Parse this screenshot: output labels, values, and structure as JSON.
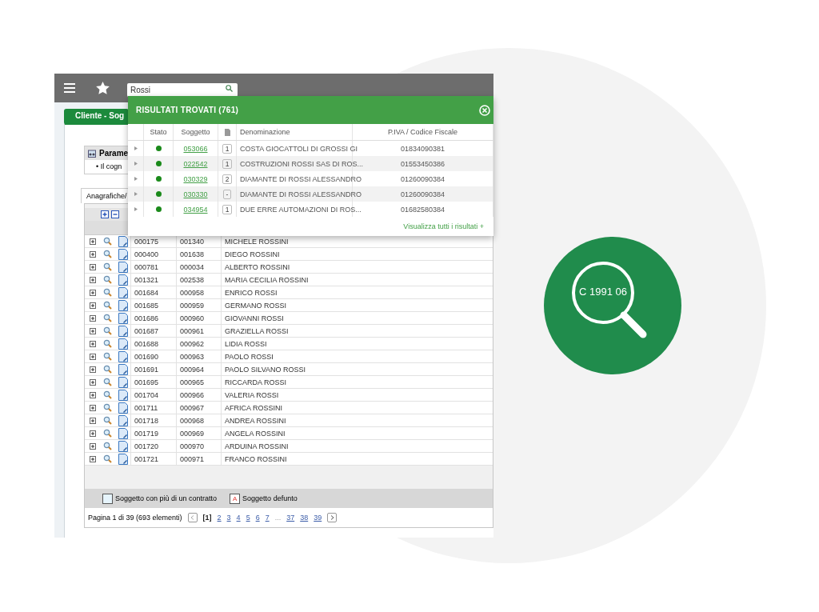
{
  "toolbar": {
    "search": {
      "value": "Rossi"
    }
  },
  "window_tab": {
    "label": "Cliente - Sog"
  },
  "params": {
    "title": "Parame",
    "note": "• Il cogn"
  },
  "content_tab": {
    "label": "Anagrafiche/"
  },
  "grid": {
    "rows": [
      {
        "code": "000175",
        "subject": "001340",
        "name": "MICHELE ROSSINI"
      },
      {
        "code": "000400",
        "subject": "001638",
        "name": "DIEGO ROSSINI"
      },
      {
        "code": "000781",
        "subject": "000034",
        "name": "ALBERTO ROSSINI"
      },
      {
        "code": "001321",
        "subject": "002538",
        "name": "MARIA CECILIA ROSSINI"
      },
      {
        "code": "001684",
        "subject": "000958",
        "name": "ENRICO ROSSI"
      },
      {
        "code": "001685",
        "subject": "000959",
        "name": "GERMANO ROSSI"
      },
      {
        "code": "001686",
        "subject": "000960",
        "name": "GIOVANNI ROSSI"
      },
      {
        "code": "001687",
        "subject": "000961",
        "name": "GRAZIELLA ROSSI"
      },
      {
        "code": "001688",
        "subject": "000962",
        "name": "LIDIA ROSSI"
      },
      {
        "code": "001690",
        "subject": "000963",
        "name": "PAOLO ROSSI"
      },
      {
        "code": "001691",
        "subject": "000964",
        "name": "PAOLO SILVANO ROSSI"
      },
      {
        "code": "001695",
        "subject": "000965",
        "name": "RICCARDA ROSSI"
      },
      {
        "code": "001704",
        "subject": "000966",
        "name": "VALERIA ROSSI"
      },
      {
        "code": "001711",
        "subject": "000967",
        "name": "AFRICA ROSSINI"
      },
      {
        "code": "001718",
        "subject": "000968",
        "name": "ANDREA ROSSINI"
      },
      {
        "code": "001719",
        "subject": "000969",
        "name": "ANGELA ROSSINI"
      },
      {
        "code": "001720",
        "subject": "000970",
        "name": "ARDUINA ROSSINI"
      },
      {
        "code": "001721",
        "subject": "000971",
        "name": "FRANCO ROSSINI"
      }
    ]
  },
  "legend": [
    {
      "kind": "multi",
      "label": "Soggetto con più di un contratto"
    },
    {
      "kind": "deceased",
      "mark": "A",
      "label": "Soggetto defunto"
    }
  ],
  "pagination": {
    "summary": "Pagina 1 di 39 (693 elementi)",
    "pages": [
      {
        "kind": "page",
        "label": "[1]",
        "selected": true
      },
      {
        "kind": "page",
        "label": "2",
        "selected": false
      },
      {
        "kind": "page",
        "label": "3",
        "selected": false
      },
      {
        "kind": "page",
        "label": "4",
        "selected": false
      },
      {
        "kind": "page",
        "label": "5",
        "selected": false
      },
      {
        "kind": "page",
        "label": "6",
        "selected": false
      },
      {
        "kind": "page",
        "label": "7",
        "selected": false
      },
      {
        "kind": "ellipsis",
        "label": "...",
        "selected": false
      },
      {
        "kind": "page",
        "label": "37",
        "selected": false
      },
      {
        "kind": "page",
        "label": "38",
        "selected": false
      },
      {
        "kind": "page",
        "label": "39",
        "selected": false
      }
    ]
  },
  "results": {
    "title": "RISULTATI TROVATI (761)",
    "columns": [
      "Stato",
      "Soggetto",
      "Denominazione",
      "P.IVA / Codice Fiscale"
    ],
    "rows": [
      {
        "subject": "053066",
        "count": "1",
        "name": "COSTA GIOCATTOLI DI GROSSI GI",
        "tax_id": "01834090381"
      },
      {
        "subject": "022542",
        "count": "1",
        "name": "COSTRUZIONI ROSSI SAS DI ROS...",
        "tax_id": "01553450386"
      },
      {
        "subject": "030329",
        "count": "2",
        "name": "DIAMANTE DI ROSSI ALESSANDRO",
        "tax_id": "01260090384"
      },
      {
        "subject": "030330",
        "count": "-",
        "name": "DIAMANTE DI ROSSI ALESSANDRO",
        "tax_id": "01260090384"
      },
      {
        "subject": "034954",
        "count": "1",
        "name": "DUE ERRE AUTOMAZIONI DI ROS...",
        "tax_id": "01682580384"
      }
    ],
    "footer_link": "Visualizza tutti i risultati +"
  },
  "badge": {
    "label": "C 1991 06"
  }
}
